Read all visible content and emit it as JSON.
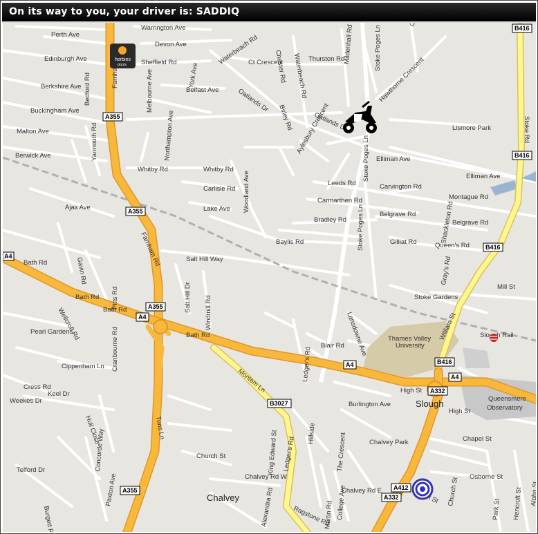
{
  "header": {
    "text": "On its way to you, your driver is: SADDIQ"
  },
  "map": {
    "places": [
      "Slough",
      "Chalvey",
      "Thames Valley",
      "University",
      "Queensmere",
      "Observatory",
      "Slough Rail"
    ],
    "store_logo": {
      "line1": "herbies",
      "line2": "pizza"
    },
    "road_shields": [
      "A355",
      "A355",
      "A355",
      "A355",
      "A4",
      "A4",
      "A4",
      "A4",
      "A332",
      "A332",
      "A412",
      "B416",
      "B416",
      "B416",
      "B416",
      "B3027"
    ],
    "streets": [
      "Warrington Ave",
      "Perth Ave",
      "Devon Ave",
      "Edinburgh Ave",
      "Sheffield Rd",
      "York Ave",
      "Berkshire Ave",
      "Belfast Ave",
      "Buckingham Ave",
      "Oatlands Dr",
      "Ct Crescent",
      "Thurston Rd",
      "Waterbeach Rd",
      "Chester Rd",
      "Stoke Poges Ln",
      "Mildenhall Rd",
      "Hawthorne Crescent",
      "Cromwell",
      "Lismore Park",
      "Stoke Rd",
      "Malton Ave",
      "Berwick Ave",
      "Whitby Rd",
      "Elliman Ave",
      "Leeds Rd",
      "Carvington Rd",
      "Montague Rd",
      "Carlisle Rd",
      "Carmarthen Rd",
      "Lake Ave",
      "Ajax Ave",
      "Bradley Rd",
      "Belgrave Rd",
      "Gilliat Rd",
      "Queen's Rd",
      "Baylis Rd",
      "Salt Hill Way",
      "Bath Rd",
      "Mill St",
      "Stoke Gardens",
      "William St",
      "Blair Rd",
      "High St",
      "Cippenham Ln",
      "Keel Dr",
      "Cress Rd",
      "Weekes Dr",
      "Montem Ln",
      "Ledger's Rd",
      "Burlington Ave",
      "Chalvey Park",
      "Church St",
      "Chapel St",
      "Osborne St",
      "Albert St",
      "Chalvey Rd E",
      "Chalvey Rd W",
      "Ragstone Rd",
      "Telford Dr",
      "Burgett Rd",
      "Concorde Way",
      "Paxton Ave",
      "Alexandra Rd",
      "King Edward St",
      "Martin Rd",
      "College Ave",
      "The Crescent",
      "Park St",
      "Alpha St",
      "Hencroft St",
      "Whitby Rd",
      "Farnham Rd",
      "Gray's Rd",
      "Shackleton Rd",
      "Woodland Ave",
      "Windmill Rd",
      "Salt Hill Dr",
      "Pitts Rd",
      "Cranbourne Rd",
      "Hull Close",
      "Pearl Gardens",
      "Wellcroft Rd",
      "Yarmouth Rd",
      "Bedford Rd",
      "Melbourne Ave",
      "Northampton Ave",
      "Birley Rd",
      "Aylesbury Crescent",
      "Lansdowne Ave",
      "Hillside",
      "Tuns Ln",
      "Gavin Rd",
      "Stoke Poges Ln"
    ]
  }
}
